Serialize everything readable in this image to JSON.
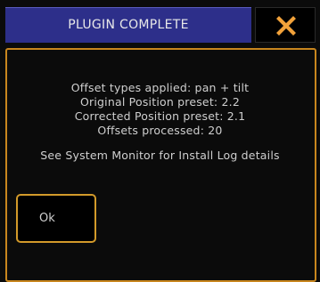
{
  "dialog": {
    "title": "PLUGIN COMPLETE",
    "close_icon": "close-x-icon",
    "messages": [
      "Offset types applied: pan + tilt",
      "Original Position preset: 2.2",
      "Corrected Position preset: 2.1",
      "Offsets processed: 20"
    ],
    "note": "See System Monitor for Install Log details",
    "ok_label": "Ok"
  },
  "colors": {
    "title_bar": "#2d2f8a",
    "accent_border": "#c8861e",
    "close_icon": "#f2a23a",
    "background": "#0b0b0b",
    "text": "#cfcfcf"
  }
}
